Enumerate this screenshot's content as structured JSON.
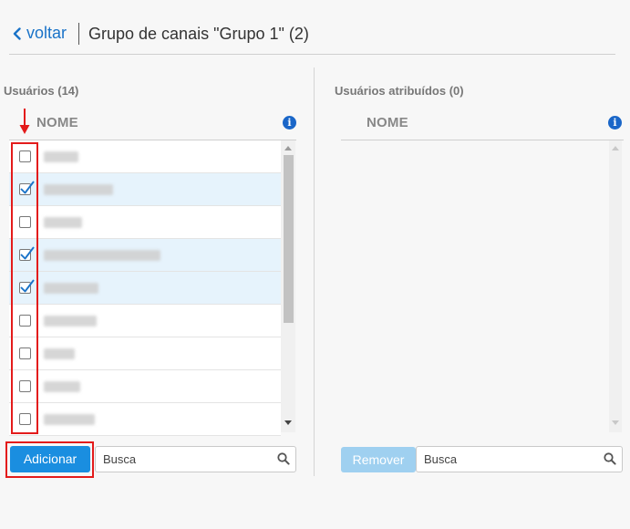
{
  "header": {
    "back_label": "voltar",
    "title": "Grupo de canais \"Grupo 1\" (2)"
  },
  "left": {
    "title": "Usuários (14)",
    "column": "NOME",
    "rows": [
      {
        "checked": false
      },
      {
        "checked": true
      },
      {
        "checked": false
      },
      {
        "checked": true
      },
      {
        "checked": true
      },
      {
        "checked": false
      },
      {
        "checked": false
      },
      {
        "checked": false
      },
      {
        "checked": false
      }
    ],
    "add_label": "Adicionar",
    "search_placeholder": "Busca"
  },
  "right": {
    "title": "Usuários atribuídos (0)",
    "column": "NOME",
    "remove_label": "Remover",
    "search_placeholder": "Busca"
  },
  "colors": {
    "accent": "#1a8ee0",
    "link": "#1a73c8",
    "selected_row": "#e6f3fc",
    "annotation": "#e31b1b"
  },
  "icons": [
    "chevron-left-icon",
    "info-icon",
    "search-icon",
    "checkmark-icon",
    "annotation-arrow-icon"
  ]
}
